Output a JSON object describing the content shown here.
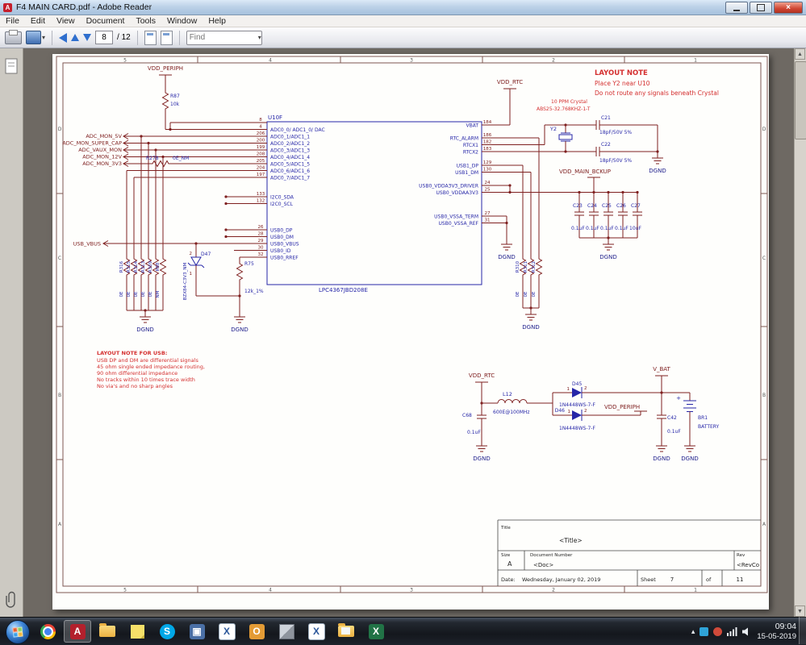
{
  "window": {
    "title": "F4 MAIN CARD.pdf - Adobe Reader"
  },
  "menu": {
    "items": [
      "File",
      "Edit",
      "View",
      "Document",
      "Tools",
      "Window",
      "Help"
    ]
  },
  "toolbar": {
    "page_value": "8",
    "page_total": "/ 12",
    "find_placeholder": "Find"
  },
  "taskbar": {
    "time": "09:04",
    "date": "15-05-2019"
  },
  "schematic": {
    "dgnd": "DGND",
    "frame": {
      "cols": [
        "5",
        "4",
        "3",
        "2",
        "1"
      ],
      "rows": [
        "D",
        "C",
        "B",
        "A"
      ]
    },
    "notes": {
      "layout": {
        "title": "LAYOUT NOTE",
        "line1": "Place Y2 near U10",
        "line2": "Do not route any signals beneath Crystal"
      },
      "crystal": "10 PPM Crystal",
      "usb": {
        "title": "LAYOUT NOTE FOR USB:",
        "lines": [
          "USB DP and DM are differential signals",
          "45 ohm single ended impedance routing,",
          "90 ohm differential impedance",
          "No tracks within 10 times trace width",
          "No via's and no sharp angles"
        ]
      }
    },
    "nets": {
      "vdd_periph": "VDD_PERIPH",
      "vdd_rtc": "VDD_RTC",
      "vdd_main_bckup": "VDD_MAIN_BCKUP",
      "v_bat": "V_BAT",
      "usb_vbus": "USB_VBUS"
    },
    "adc_labels": [
      "ADC_MON_5V",
      "ADC_MON_SUPER_CAP",
      "ADC_VAUX_MON",
      "ADC_MON_12V",
      "ADC_MON_3V3"
    ],
    "chip": {
      "ref": "U10F",
      "part": "LPC4367JBD208E",
      "left_pins": [
        {
          "num": "8",
          "name": ""
        },
        {
          "num": "4",
          "name": "ADC0_0/ ADC1_0/ DAC"
        },
        {
          "num": "206",
          "name": "ADC0_1/ADC1_1"
        },
        {
          "num": "200",
          "name": "ADC0_2/ADC1_2"
        },
        {
          "num": "199",
          "name": "ADC0_3/ADC1_3"
        },
        {
          "num": "208",
          "name": "ADC0_4/ADC1_4"
        },
        {
          "num": "205",
          "name": "ADC0_5/ADC1_5"
        },
        {
          "num": "204",
          "name": "ADC0_6/ADC1_6"
        },
        {
          "num": "197",
          "name": "ADC0_7/ADC1_7"
        }
      ],
      "i2c_pins": [
        {
          "num": "133",
          "name": "I2C0_SDA"
        },
        {
          "num": "132",
          "name": "I2C0_SCL"
        }
      ],
      "usb_pins": [
        {
          "num": "26",
          "name": "USB0_DP"
        },
        {
          "num": "28",
          "name": "USB0_DM"
        },
        {
          "num": "29",
          "name": "USB0_VBUS"
        },
        {
          "num": "30",
          "name": "USB0_ID"
        },
        {
          "num": "32",
          "name": "USB0_RREF"
        }
      ],
      "right_pins": [
        {
          "num": "184",
          "name": "VBAT"
        },
        {
          "num": "186",
          "name": "RTC_ALARM"
        },
        {
          "num": "182",
          "name": "RTCX1"
        },
        {
          "num": "183",
          "name": "RTCX2"
        },
        {
          "num": "129",
          "name": "USB1_DP"
        },
        {
          "num": "130",
          "name": "USB1_DM"
        },
        {
          "num": "24",
          "name": "USB0_VDDA3V3_DRIVER"
        },
        {
          "num": "25",
          "name": "USB0_VDDAA3V3"
        },
        {
          "num": "27",
          "name": "USB0_VSSA_TERM"
        },
        {
          "num": "31",
          "name": "USB0_VSSA_REF"
        }
      ]
    },
    "parts": {
      "r87": {
        "ref": "R87",
        "value": "10k"
      },
      "r278": {
        "ref": "R278",
        "value": "0E_NM"
      },
      "r75": {
        "ref": "R75",
        "value": "12k_1%"
      },
      "d47": {
        "ref": "D47",
        "value": "BZX84-C3V3_NM",
        "pin1": "1",
        "pin2": "2"
      },
      "y2": {
        "ref": "Y2",
        "value": "ABS25-32.768KHZ-1-T"
      },
      "c21": {
        "ref": "C21",
        "value": "18pF/50V 5%"
      },
      "c22": {
        "ref": "C22",
        "value": "18pF/50V 5%"
      },
      "l12": {
        "ref": "L12",
        "value": "600E@100MHz"
      },
      "c68": {
        "ref": "C68",
        "value": "0.1uF"
      },
      "c42": {
        "ref": "C42",
        "value": "0.1uF"
      },
      "d45": {
        "ref": "D45",
        "value": "1N4448WS-7-F",
        "pin1": "1",
        "pin2": "2"
      },
      "d46": {
        "ref": "D46",
        "value": "1N4448WS-7-F",
        "pin1": "1",
        "pin2": "2"
      },
      "br1": {
        "ref": "BR1",
        "value": "BATTERY",
        "plus": "+"
      }
    },
    "left_array": [
      {
        "ref": "R316",
        "value": "0E"
      },
      {
        "ref": "R315",
        "value": "0E"
      },
      {
        "ref": "R314",
        "value": "0E"
      },
      {
        "ref": "R313",
        "value": "0E"
      },
      {
        "ref": "R309",
        "value": "0E"
      },
      {
        "ref": "R88",
        "value": "NM"
      }
    ],
    "right_array": [
      {
        "ref": "R310",
        "value": "0E"
      },
      {
        "ref": "R311",
        "value": "0E"
      },
      {
        "ref": "R312",
        "value": "0E"
      }
    ],
    "cap_bank": [
      {
        "ref": "C23",
        "value": "0.1uF"
      },
      {
        "ref": "C24",
        "value": "0.1uF"
      },
      {
        "ref": "C25",
        "value": "0.1uF"
      },
      {
        "ref": "C26",
        "value": "0.1uF"
      },
      {
        "ref": "C27",
        "value": "10uF"
      }
    ],
    "title_block": {
      "title_label": "Title",
      "title_value": "<Title>",
      "size_label": "Size",
      "size_value": "A",
      "doc_label": "Document Number",
      "doc_value": "<Doc>",
      "rev_label": "Rev",
      "rev_value": "<RevCo",
      "date_label": "Date:",
      "date_value": "Wednesday, January 02, 2019",
      "sheet_label": "Sheet",
      "sheet_value": "7",
      "of_label": "of",
      "pages_value": "11"
    }
  }
}
